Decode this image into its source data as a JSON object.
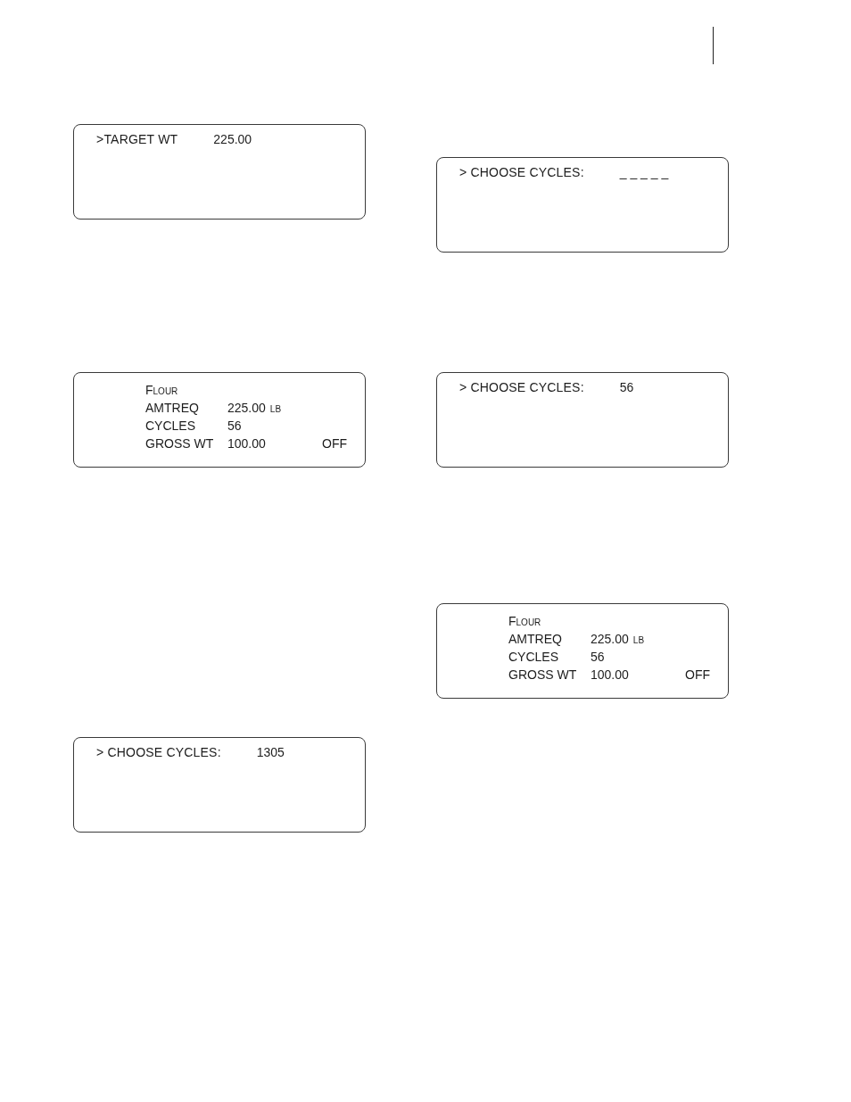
{
  "columns": [
    {
      "displays": [
        {
          "kind": "prompt",
          "prompt": ">TARGET WT",
          "value": "225.00"
        },
        {
          "kind": "status",
          "product": "Flour",
          "rows": [
            {
              "label": "AMTREQ",
              "value": "225.00",
              "unit": "lb"
            },
            {
              "label": "CYCLES",
              "value": "56"
            },
            {
              "label": "GROSS WT",
              "value": "100.00",
              "status": "OFF"
            }
          ]
        },
        {
          "kind": "prompt",
          "prompt": "> CHOOSE CYCLES:",
          "value": "1305"
        }
      ]
    },
    {
      "displays": [
        {
          "kind": "prompt",
          "prompt": "> CHOOSE CYCLES:",
          "value": "_ _ _ _ _"
        },
        {
          "kind": "prompt",
          "prompt": "> CHOOSE CYCLES:",
          "value": "56"
        },
        {
          "kind": "status",
          "product": "Flour",
          "rows": [
            {
              "label": "AMTREQ",
              "value": "225.00",
              "unit": "lb"
            },
            {
              "label": "CYCLES",
              "value": "56"
            },
            {
              "label": "GROSS WT",
              "value": "100.00",
              "status": "OFF"
            }
          ]
        }
      ]
    }
  ]
}
